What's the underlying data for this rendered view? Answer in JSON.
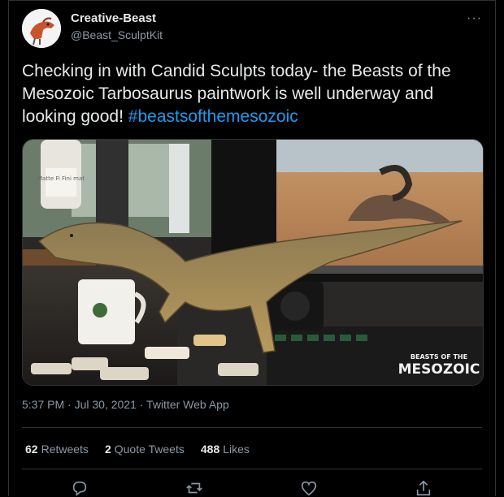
{
  "author": {
    "display_name": "Creative-Beast",
    "handle": "@Beast_SculptKit"
  },
  "tweet": {
    "text": "Checking in with Candid Sculpts today- the Beasts of the Mesozoic Tarbosaurus paintwork is well underway and looking good! ",
    "hashtag": "#beastsofthemesozoic"
  },
  "media": {
    "description_icon": "photo",
    "paint_bottle_label": "Matte Fi Fini mat",
    "logo_top": "BEASTS OF THE",
    "logo_bottom": "MESOZOIC"
  },
  "meta": {
    "timestamp": "5:37 PM · Jul 30, 2021 · Twitter Web App"
  },
  "stats": {
    "retweets_count": "62",
    "retweets_label": "Retweets",
    "quote_count": "2",
    "quote_label": "Quote Tweets",
    "likes_count": "488",
    "likes_label": "Likes"
  },
  "actions": [
    "reply-icon",
    "retweet-icon",
    "like-icon",
    "share-icon"
  ],
  "colors": {
    "background": "#000000",
    "link": "#1d9bf0",
    "text": "#e7e9ea",
    "muted": "#8b98a5",
    "border": "#2f3336"
  }
}
